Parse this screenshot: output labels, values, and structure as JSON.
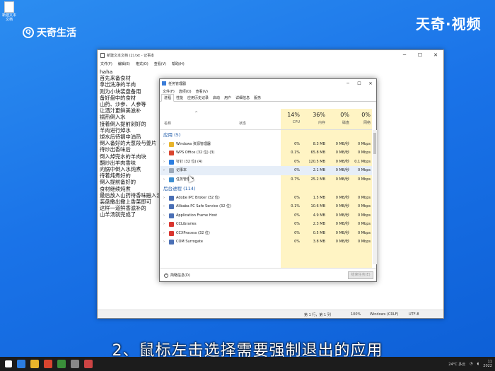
{
  "brand": {
    "left": "天奇生活",
    "right": "天奇·视频"
  },
  "desktop_icon_label": "新建文本文档",
  "notepad": {
    "title": "新建文本文档 (2).txt - 记事本",
    "menu": [
      "文件(F)",
      "编辑(E)",
      "格式(O)",
      "查看(V)",
      "帮助(H)"
    ],
    "lines": [
      "haha",
      "首先来备食材",
      "拿出洗净的羊肉",
      "则为小块装盘备用",
      "备好盘中的食材",
      "山药、沙参、人参等",
      "让洒汁更鲜美滋补",
      "锅热倒入水",
      "接着倒入提前剁好的",
      "羊肉进行焯水",
      "焯水后待锅中油热",
      "倒入备好的大葱段与姜片",
      "待炒出香味后",
      "倒入焯完水的羊肉块",
      "翻炒出羊肉香味",
      "向锅中倒入水炖煮",
      "待着炖煮好的",
      "倒入提前备好的",
      "食材继续炖煮",
      "最后放入山药待香味融入汤",
      "装盘撒出撒上香菜即可",
      "这样一道鲜香滋补的",
      "山羊汤就完成了"
    ],
    "status": {
      "pos": "第 1 行，第 1 列",
      "zoom": "100%",
      "eol": "Windows (CRLF)",
      "enc": "UTF-8"
    }
  },
  "taskmgr": {
    "title": "任务管理器",
    "menu": [
      "文件(F)",
      "选项(O)",
      "查看(V)"
    ],
    "tabs": [
      "进程",
      "性能",
      "应用历史记录",
      "启动",
      "用户",
      "详细信息",
      "服务"
    ],
    "headers": {
      "name": "名称",
      "status": "状态",
      "cpu_pct": "14%",
      "cpu": "CPU",
      "mem_pct": "36%",
      "mem": "内存",
      "disk_pct": "0%",
      "disk": "磁盘",
      "net_pct": "0%",
      "net": "网络"
    },
    "group_apps": "应用 (5)",
    "apps": [
      {
        "name": "Windows 资源管理器",
        "cpu": "0%",
        "mem": "8.3 MB",
        "disk": "0 MB/秒",
        "net": "0 Mbps",
        "color": "#e8b42b"
      },
      {
        "name": "WPS Office (32 位) (3)",
        "cpu": "0.1%",
        "mem": "65.8 MB",
        "disk": "0 MB/秒",
        "net": "0 Mbps",
        "color": "#d9452f"
      },
      {
        "name": "钉钉 (32 位) (4)",
        "cpu": "0%",
        "mem": "120.5 MB",
        "disk": "0 MB/秒",
        "net": "0.1 Mbps",
        "color": "#2b7de0"
      },
      {
        "name": "记事本",
        "cpu": "0%",
        "mem": "2.1 MB",
        "disk": "0 MB/秒",
        "net": "0 Mbps",
        "color": "#9aa8b8"
      },
      {
        "name": "任务管理器",
        "cpu": "0.7%",
        "mem": "25.2 MB",
        "disk": "0 MB/秒",
        "net": "0 Mbps",
        "color": "#3e8ed0"
      }
    ],
    "group_bg": "后台进程 (114)",
    "bg": [
      {
        "name": "Adobe IPC Broker (32 位)",
        "cpu": "0%",
        "mem": "1.5 MB",
        "disk": "0 MB/秒",
        "net": "0 Mbps",
        "color": "#4a6fb5"
      },
      {
        "name": "Alibaba PC Safe Service (32 位)",
        "cpu": "0.1%",
        "mem": "10.6 MB",
        "disk": "0 MB/秒",
        "net": "0 Mbps",
        "color": "#4a6fb5"
      },
      {
        "name": "Application Frame Host",
        "cpu": "0%",
        "mem": "4.9 MB",
        "disk": "0 MB/秒",
        "net": "0 Mbps",
        "color": "#4a6fb5"
      },
      {
        "name": "CCLibraries",
        "cpu": "0%",
        "mem": "2.3 MB",
        "disk": "0 MB/秒",
        "net": "0 Mbps",
        "color": "#d9352f"
      },
      {
        "name": "CCXProcess (32 位)",
        "cpu": "0%",
        "mem": "0.5 MB",
        "disk": "0 MB/秒",
        "net": "0 Mbps",
        "color": "#d9352f"
      },
      {
        "name": "COM Surrogate",
        "cpu": "0%",
        "mem": "3.8 MB",
        "disk": "0 MB/秒",
        "net": "0 Mbps",
        "color": "#4a6fb5"
      }
    ],
    "less": "简略信息(D)",
    "end_task": "结束任务(E)"
  },
  "caption": "2、鼠标左击选择需要强制退出的应用",
  "tray": {
    "weather": "24°C 多云",
    "time": "11",
    "date": "2022"
  }
}
